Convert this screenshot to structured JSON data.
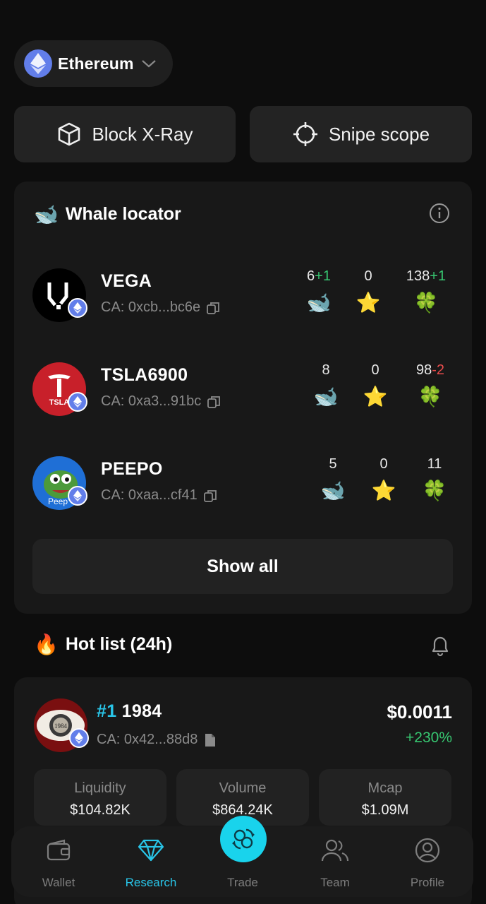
{
  "chain": {
    "name": "Ethereum"
  },
  "tools": [
    {
      "label": "Block X-Ray",
      "icon": "cube-icon"
    },
    {
      "label": "Snipe scope",
      "icon": "crosshair-icon"
    }
  ],
  "whale_locator": {
    "title": "Whale locator",
    "title_emoji": "🐋",
    "info_icon": "info-icon",
    "tokens": [
      {
        "name": "VEGA",
        "ca": "CA: 0xcb...bc6e",
        "whales": "6",
        "whales_delta": "+1",
        "stars": "0",
        "clovers": "138",
        "clovers_delta": "+1"
      },
      {
        "name": "TSLA6900",
        "ca": "CA: 0xa3...91bc",
        "whales": "8",
        "whales_delta": "",
        "stars": "0",
        "clovers": "98",
        "clovers_delta": "-2"
      },
      {
        "name": "PEEPO",
        "ca": "CA: 0xaa...cf41",
        "whales": "5",
        "whales_delta": "",
        "stars": "0",
        "clovers": "11",
        "clovers_delta": ""
      }
    ],
    "stat_icons": {
      "whale": "🐋",
      "star": "⭐",
      "clover": "🍀"
    },
    "show_all": "Show all"
  },
  "hot_list": {
    "title": "Hot list (24h)",
    "title_emoji": "🔥",
    "top": {
      "rank": "#1",
      "name": "1984",
      "ca": "CA: 0x42...88d8",
      "price": "$0.0011",
      "change": "+230%",
      "metrics": [
        {
          "label": "Liquidity",
          "value": "$104.82K"
        },
        {
          "label": "Volume",
          "value": "$864.24K"
        },
        {
          "label": "Mcap",
          "value": "$1.09M"
        }
      ]
    }
  },
  "nav": {
    "items": [
      {
        "label": "Wallet",
        "icon": "wallet-icon",
        "active": false
      },
      {
        "label": "Research",
        "icon": "diamond-icon",
        "active": true
      },
      {
        "label": "Trade",
        "icon": "swap-icon",
        "active": false
      },
      {
        "label": "Team",
        "icon": "team-icon",
        "active": false
      },
      {
        "label": "Profile",
        "icon": "profile-icon",
        "active": false
      }
    ]
  },
  "colors": {
    "accent": "#29c5e8",
    "positive": "#37c771",
    "negative": "#e64c4c",
    "eth": "#627eea"
  }
}
